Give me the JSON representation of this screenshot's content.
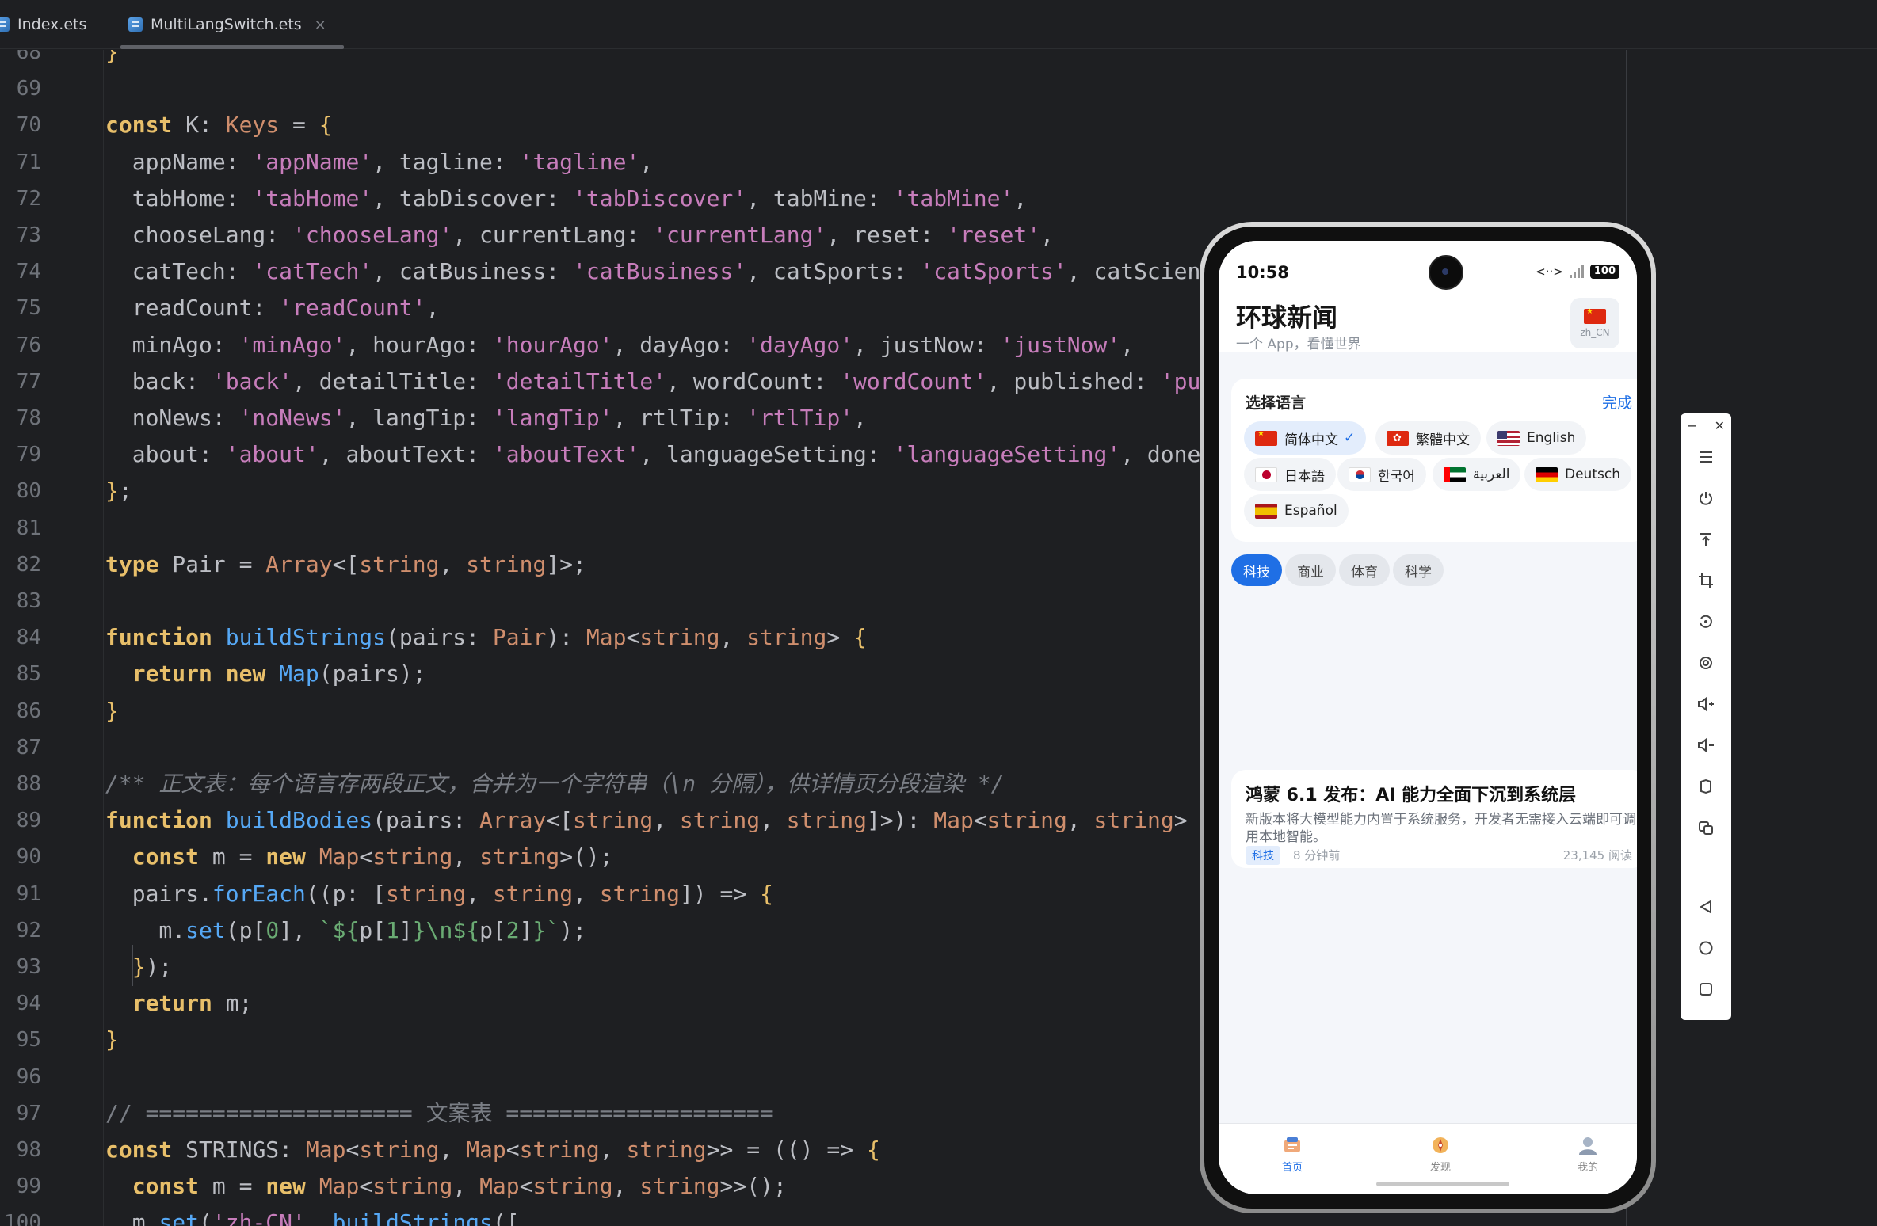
{
  "tabs": [
    {
      "label": "Index.ets"
    },
    {
      "label": "MultiLangSwitch.ets",
      "close": "×"
    }
  ],
  "code_lines": [
    {
      "num": "68",
      "html": "<span class='y'>}</span>"
    },
    {
      "num": "69",
      "html": ""
    },
    {
      "num": "70",
      "html": "<span class='kw'>const</span> K: <span class='t'>Keys</span> = <span class='y'>{</span>"
    },
    {
      "num": "71",
      "html": "  appName: <span class='s'>'appName'</span>, tagline: <span class='s'>'tagline'</span>,"
    },
    {
      "num": "72",
      "html": "  tabHome: <span class='s'>'tabHome'</span>, tabDiscover: <span class='s'>'tabDiscover'</span>, tabMine: <span class='s'>'tabMine'</span>,"
    },
    {
      "num": "73",
      "html": "  chooseLang: <span class='s'>'chooseLang'</span>, currentLang: <span class='s'>'currentLang'</span>, reset: <span class='s'>'reset'</span>,"
    },
    {
      "num": "74",
      "html": "  catTech: <span class='s'>'catTech'</span>, catBusiness: <span class='s'>'catBusiness'</span>, catSports: <span class='s'>'catSports'</span>, catScience: <span class='s'>'catScience'</span>,"
    },
    {
      "num": "75",
      "html": "  readCount: <span class='s'>'readCount'</span>,"
    },
    {
      "num": "76",
      "html": "  minAgo: <span class='s'>'minAgo'</span>, hourAgo: <span class='s'>'hourAgo'</span>, dayAgo: <span class='s'>'dayAgo'</span>, justNow: <span class='s'>'justNow'</span>,"
    },
    {
      "num": "77",
      "html": "  back: <span class='s'>'back'</span>, detailTitle: <span class='s'>'detailTitle'</span>, wordCount: <span class='s'>'wordCount'</span>, published: <span class='s'>'published'</span>,"
    },
    {
      "num": "78",
      "html": "  noNews: <span class='s'>'noNews'</span>, langTip: <span class='s'>'langTip'</span>, rtlTip: <span class='s'>'rtlTip'</span>,"
    },
    {
      "num": "79",
      "html": "  about: <span class='s'>'about'</span>, aboutText: <span class='s'>'aboutText'</span>, languageSetting: <span class='s'>'languageSetting'</span>, done: <span class='s'>'done'</span>"
    },
    {
      "num": "80",
      "html": "<span class='y'>}</span>;"
    },
    {
      "num": "81",
      "html": ""
    },
    {
      "num": "82",
      "html": "<span class='kw'>type</span> Pair = <span class='t'>Array</span>&lt;[<span class='t'>string</span>, <span class='t'>string</span>]&gt;;"
    },
    {
      "num": "83",
      "html": ""
    },
    {
      "num": "84",
      "html": "<span class='kw'>function</span> <span class='f'>buildStrings</span>(pairs: <span class='t'>Pair</span>): <span class='t'>Map</span>&lt;<span class='t'>string</span>, <span class='t'>string</span>&gt; <span class='y'>{</span>"
    },
    {
      "num": "85",
      "html": "  <span class='kw'>return</span> <span class='kw'>new</span> <span class='f'>Map</span>(pairs);"
    },
    {
      "num": "86",
      "html": "<span class='y'>}</span>"
    },
    {
      "num": "87",
      "html": ""
    },
    {
      "num": "88",
      "html": "<span class='c'>/** 正文表：每个语言存两段正文，合并为一个字符串（\\n 分隔），供详情页分段渲染 */</span>"
    },
    {
      "num": "89",
      "html": "<span class='kw'>function</span> <span class='f'>buildBodies</span>(pairs: <span class='t'>Array</span>&lt;[<span class='t'>string</span>, <span class='t'>string</span>, <span class='t'>string</span>]&gt;): <span class='t'>Map</span>&lt;<span class='t'>string</span>, <span class='t'>string</span>&gt; <span class='y'>{</span>"
    },
    {
      "num": "90",
      "html": "  <span class='kw'>const</span> m = <span class='kw'>new</span> <span class='t'>Map</span>&lt;<span class='t'>string</span>, <span class='t'>string</span>&gt;();"
    },
    {
      "num": "91",
      "html": "  pairs.<span class='f'>forEach</span>((p: [<span class='t'>string</span>, <span class='t'>string</span>, <span class='t'>string</span>]) =&gt; <span class='y'>{</span>"
    },
    {
      "num": "92",
      "html": "    m.<span class='f'>set</span>(p[<span class='g'>0</span>], <span class='g'>`${</span>p[<span class='g'>1</span>]<span class='g'>}\\n${</span>p[<span class='g'>2</span>]<span class='g'>}`</span>);"
    },
    {
      "num": "93",
      "html": "  <span class='y'>}</span>);"
    },
    {
      "num": "94",
      "html": "  <span class='kw'>return</span> m;"
    },
    {
      "num": "95",
      "html": "<span class='y'>}</span>"
    },
    {
      "num": "96",
      "html": ""
    },
    {
      "num": "97",
      "html": "<span class='c' style='font-style:normal'>// ==================== 文案表 ====================</span>"
    },
    {
      "num": "98",
      "html": "<span class='kw'>const</span> STRINGS: <span class='t'>Map</span>&lt;<span class='t'>string</span>, <span class='t'>Map</span>&lt;<span class='t'>string</span>, <span class='t'>string</span>&gt;&gt; = (() =&gt; <span class='y'>{</span>"
    },
    {
      "num": "99",
      "html": "  <span class='kw'>const</span> m = <span class='kw'>new</span> <span class='t'>Map</span>&lt;<span class='t'>string</span>, <span class='t'>Map</span>&lt;<span class='t'>string</span>, <span class='t'>string</span>&gt;&gt;();"
    },
    {
      "num": "100",
      "html": "  m.<span class='f'>set</span>(<span class='s'>'zh-CN'</span>, <span class='f'>buildStrings</span>(["
    }
  ],
  "phone": {
    "status": {
      "time": "10:58",
      "signal_text": "<··>",
      "battery": "100"
    },
    "app": {
      "title": "环球新闻",
      "tagline": "一个 App，看懂世界",
      "lang_code": "zh_CN"
    },
    "lang_card": {
      "title": "选择语言",
      "done": "完成",
      "check": "✓",
      "languages": [
        {
          "label": "简体中文",
          "flag": "cn",
          "active": true
        },
        {
          "label": "繁體中文",
          "flag": "hk"
        },
        {
          "label": "English",
          "flag": "us"
        },
        {
          "label": "日本語",
          "flag": "jp"
        },
        {
          "label": "한국어",
          "flag": "kr"
        },
        {
          "label": "العربية",
          "flag": "ae"
        },
        {
          "label": "Deutsch",
          "flag": "de"
        },
        {
          "label": "Español",
          "flag": "es"
        }
      ]
    },
    "categories": [
      {
        "label": "科技",
        "active": true
      },
      {
        "label": "商业"
      },
      {
        "label": "体育"
      },
      {
        "label": "科学"
      }
    ],
    "news": {
      "title": "鸿蒙 6.1 发布：AI 能力全面下沉到系统层",
      "summary": "新版本将大模型能力内置于系统服务，开发者无需接入云端即可调用本地智能。",
      "tag": "科技",
      "time": "8 分钟前",
      "reads": "23,145 阅读"
    },
    "nav": [
      {
        "label": "首页",
        "active": true
      },
      {
        "label": "发现"
      },
      {
        "label": "我的"
      }
    ]
  },
  "emulator": {
    "minimize": "−",
    "close": "✕"
  },
  "colors": {
    "editor_bg": "#1e1f22",
    "accent": "#1f6fe5",
    "string": "#c77dbb",
    "keyword": "#e8bf6a"
  }
}
